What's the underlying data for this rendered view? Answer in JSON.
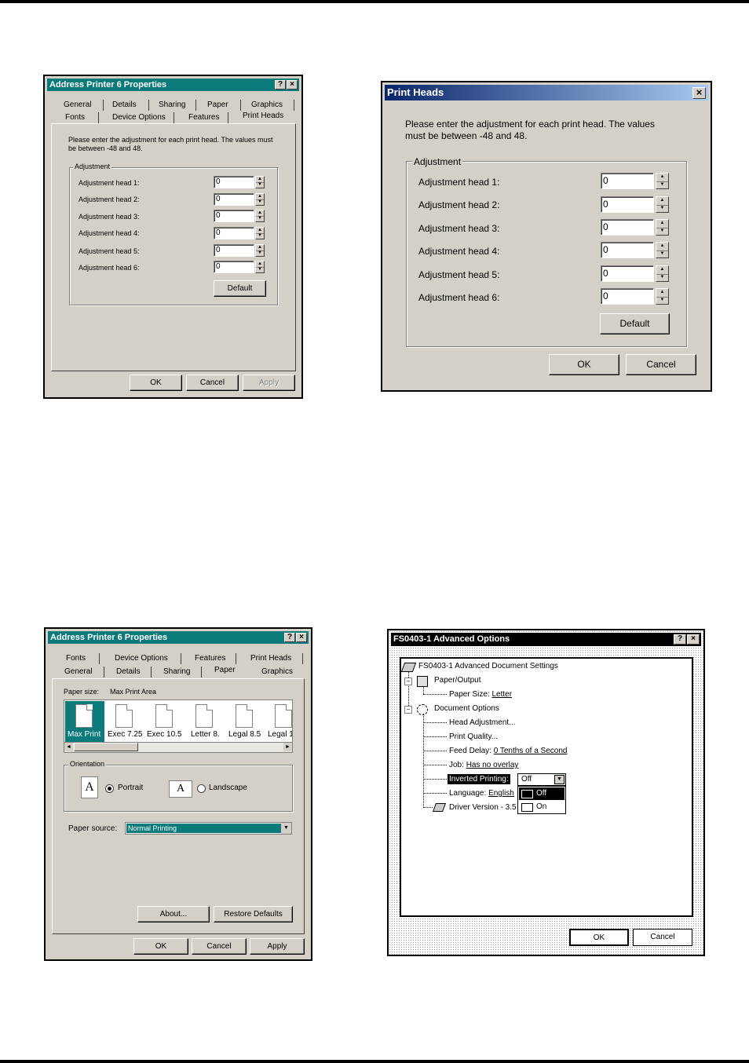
{
  "dlg1": {
    "title": "Address Printer 6 Properties",
    "help": "?",
    "close": "×",
    "tabs_row1": [
      "General",
      "Details",
      "Sharing",
      "Paper",
      "Graphics"
    ],
    "tabs_row2": [
      "Fonts",
      "Device Options",
      "Features",
      "Print Heads"
    ],
    "instructions": "Please enter the adjustment for each print head. The values must be between -48 and 48.",
    "group": "Adjustment",
    "heads": [
      {
        "label": "Adjustment head 1:",
        "value": "0"
      },
      {
        "label": "Adjustment head 2:",
        "value": "0"
      },
      {
        "label": "Adjustment head 3:",
        "value": "0"
      },
      {
        "label": "Adjustment head 4:",
        "value": "0"
      },
      {
        "label": "Adjustment head 5:",
        "value": "0"
      },
      {
        "label": "Adjustment head 6:",
        "value": "0"
      }
    ],
    "default": "Default",
    "ok": "OK",
    "cancel": "Cancel",
    "apply": "Apply"
  },
  "dlg2": {
    "title": "Print Heads",
    "close": "×",
    "instructions": "Please enter the adjustment for each print head. The values must be between -48 and 48.",
    "group": "Adjustment",
    "heads": [
      {
        "label": "Adjustment head 1:",
        "value": "0"
      },
      {
        "label": "Adjustment head 2:",
        "value": "0"
      },
      {
        "label": "Adjustment head 3:",
        "value": "0"
      },
      {
        "label": "Adjustment head 4:",
        "value": "0"
      },
      {
        "label": "Adjustment head 5:",
        "value": "0"
      },
      {
        "label": "Adjustment head 6:",
        "value": "0"
      }
    ],
    "default": "Default",
    "ok": "OK",
    "cancel": "Cancel"
  },
  "dlg3": {
    "title": "Address Printer 6 Properties",
    "help": "?",
    "close": "×",
    "tabs_row1": [
      "Fonts",
      "Device Options",
      "Features",
      "Print Heads"
    ],
    "tabs_row2": [
      "General",
      "Details",
      "Sharing",
      "Paper",
      "Graphics"
    ],
    "paper_size_label": "Paper size:",
    "paper_size_value": "Max Print Area",
    "papers": [
      "Max Print",
      "Exec 7.25",
      "Exec 10.5",
      "Letter 8.",
      "Legal 8.5",
      "Legal 1"
    ],
    "orientation": "Orientation",
    "portrait": "Portrait",
    "landscape": "Landscape",
    "paper_source_label": "Paper source:",
    "paper_source_value": "Normal Printing",
    "about": "About...",
    "restore": "Restore Defaults",
    "ok": "OK",
    "cancel": "Cancel",
    "apply": "Apply"
  },
  "dlg4": {
    "title": "FS0403-1 Advanced Options",
    "help": "?",
    "close": "×",
    "root": "FS0403-1 Advanced Document Settings",
    "paper_output": "Paper/Output",
    "paper_size_label": "Paper Size:",
    "paper_size_value": "Letter",
    "document_options": "Document Options",
    "head_adjustment": "Head Adjustment...",
    "print_quality": "Print Quality...",
    "feed_delay_label": "Feed Delay:",
    "feed_delay_value": "0 Tenths of a Second",
    "job_label": "Job:",
    "job_value": "Has no overlay",
    "inverted_label": "Inverted Printing:",
    "inverted_value": "Off",
    "options": [
      "Off",
      "On"
    ],
    "language_label": "Language:",
    "language_value": "English",
    "driver_label": "Driver Version - 3.5",
    "ok": "OK",
    "cancel": "Cancel"
  }
}
